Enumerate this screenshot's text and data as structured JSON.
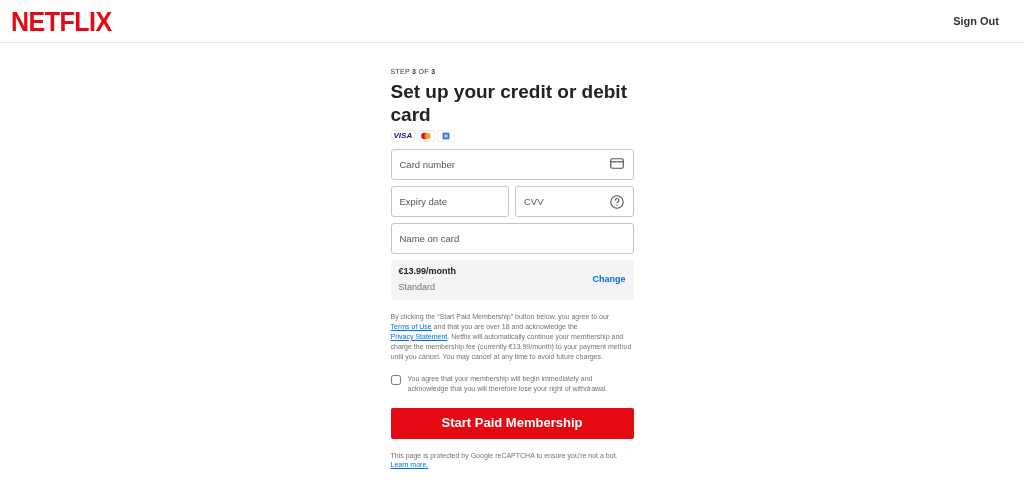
{
  "header": {
    "logo": "NETFLIX",
    "sign_out": "Sign Out"
  },
  "step": "STEP **3** OF **3**",
  "title": "Set up your credit or debit card",
  "card_badges": [
    {
      "kind": "visa",
      "text": "VISA"
    },
    {
      "kind": "mastercard"
    },
    {
      "kind": "generic"
    }
  ],
  "fields": [
    {
      "placeholder": "Card number",
      "kind": "card"
    },
    {
      "placeholder": "Expiry date",
      "kind": "plain"
    },
    {
      "placeholder": "CVV",
      "kind": "help"
    },
    {
      "placeholder": "Name on card",
      "kind": "plain"
    }
  ],
  "plan": {
    "price": "€13.99/month",
    "name": "Standard",
    "change": "Change"
  },
  "legal": {
    "before": "By clicking the “Start Paid Membership” button below, you agree to our ",
    "terms_link": "Terms of Use",
    "middle": " and that you are over 18 and acknowledge the ",
    "privacy_link": "Privacy Statement",
    "after": ". Netflix will automatically continue your membership and charge the membership fee (currently €13.99/month) to your payment method until you cancel. You may cancel at any time to avoid future charges."
  },
  "consent": {
    "label": "You agree that your membership will begin immediately and acknowledge that you will therefore lose your right of withdrawal.",
    "checked": false
  },
  "submit": "Start Paid Membership",
  "recaptcha": {
    "text": "This page is protected by Google reCAPTCHA to ensure you're not a bot.",
    "link": "Learn more."
  }
}
